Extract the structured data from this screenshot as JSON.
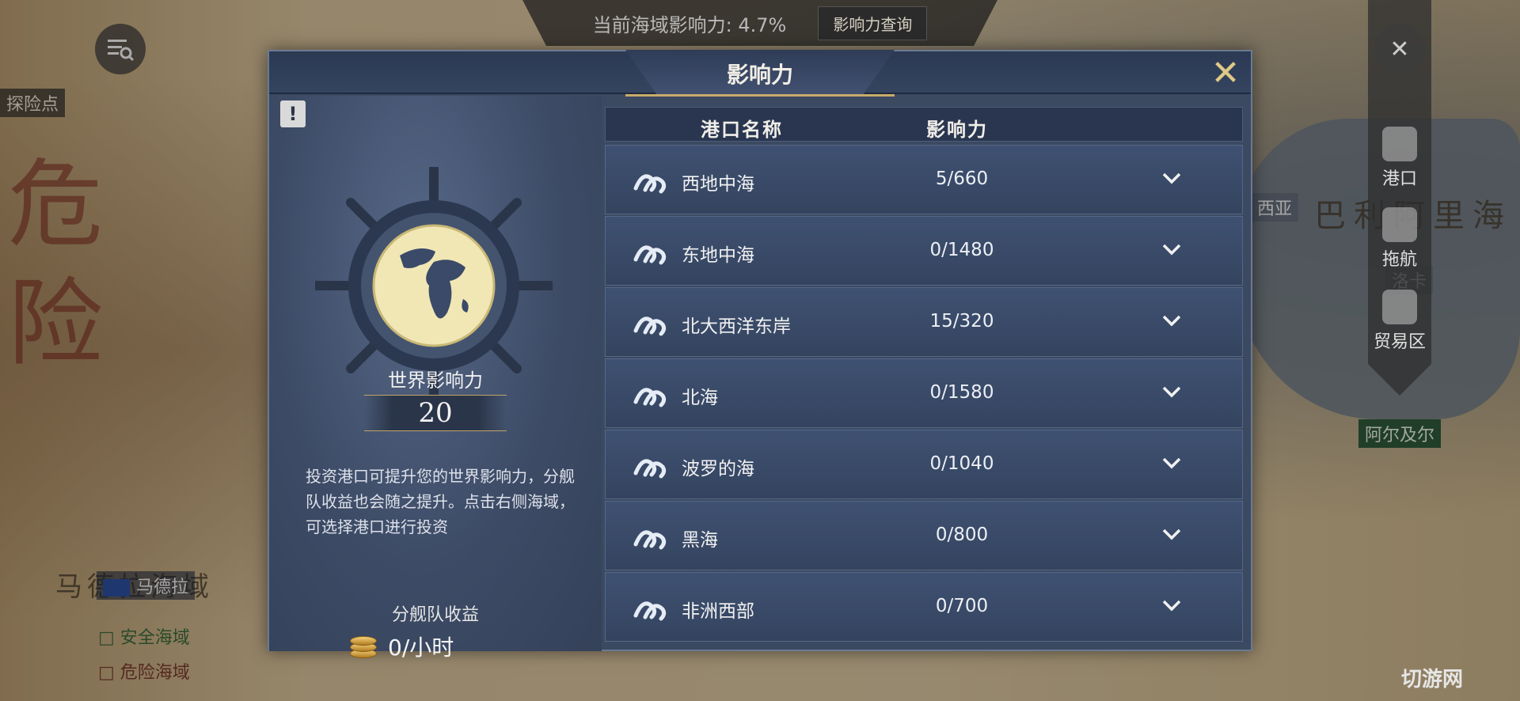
{
  "top_bar": {
    "influence_text": "当前海域影响力: 4.7%",
    "query_button": "影响力查询"
  },
  "map": {
    "left_label": "探险点",
    "right_labels": [
      "巴利阿里海",
      "阿尔及尔"
    ],
    "bottom_left_label": "马德拉",
    "legend": [
      "安全海域",
      "危险海域"
    ],
    "bottom_left_sea": "马德拉海域",
    "partial_labels": [
      "西亚",
      "洛卡"
    ]
  },
  "sidebar": {
    "items": [
      "港口",
      "拖航",
      "贸易区"
    ]
  },
  "dialog": {
    "title": "影响力",
    "info_icon": "!",
    "world_influence_label": "世界影响力",
    "world_influence_value": "20",
    "description": "投资港口可提升您的世界影响力，分舰队收益也会随之提升。点击右侧海域，可选择港口进行投资",
    "fleet_income_label": "分舰队收益",
    "fleet_income_value": "0/小时",
    "table": {
      "headers": [
        "港口名称",
        "影响力"
      ],
      "rows": [
        {
          "name": "西地中海",
          "value": "5/660"
        },
        {
          "name": "东地中海",
          "value": "0/1480"
        },
        {
          "name": "北大西洋东岸",
          "value": "15/320"
        },
        {
          "name": "北海",
          "value": "0/1580"
        },
        {
          "name": "波罗的海",
          "value": "0/1040"
        },
        {
          "name": "黑海",
          "value": "0/800"
        },
        {
          "name": "非洲西部",
          "value": "0/700"
        }
      ]
    }
  },
  "watermark": "切游网",
  "icons": [
    "menu-search-icon",
    "close-icon",
    "ship-wheel-icon",
    "globe-icon",
    "wave-icon",
    "chevron-down-icon",
    "coin-icon",
    "port-icon",
    "helm-icon",
    "money-bag-icon"
  ]
}
